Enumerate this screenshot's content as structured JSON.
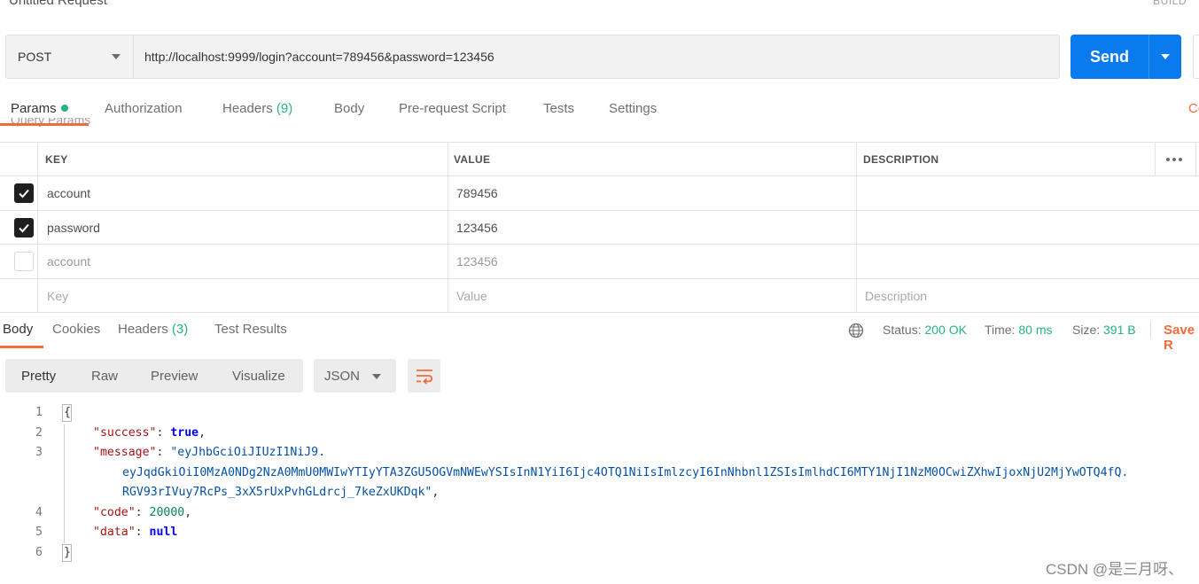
{
  "header": {
    "title": "Untitled Request",
    "build_label": "BUILD"
  },
  "request": {
    "method": "POST",
    "url": "http://localhost:9999/login?account=789456&password=123456",
    "send_label": "Send"
  },
  "request_tabs": {
    "params": "Params",
    "authorization": "Authorization",
    "headers": "Headers",
    "headers_count": "(9)",
    "body": "Body",
    "pre_request": "Pre-request Script",
    "tests": "Tests",
    "settings": "Settings",
    "cut_label": "Co"
  },
  "query_params": {
    "section_label": "Query Params",
    "columns": {
      "key": "KEY",
      "value": "VALUE",
      "description": "DESCRIPTION"
    },
    "rows": [
      {
        "key": "account",
        "value": "789456",
        "checked": true
      },
      {
        "key": "password",
        "value": "123456",
        "checked": true
      },
      {
        "key": "account",
        "value": "123456",
        "checked": false
      }
    ],
    "placeholders": {
      "key": "Key",
      "value": "Value",
      "description": "Description"
    }
  },
  "response_tabs": {
    "body": "Body",
    "cookies": "Cookies",
    "headers": "Headers",
    "headers_count": "(3)",
    "test_results": "Test Results"
  },
  "response_status": {
    "status_label": "Status:",
    "status_value": "200 OK",
    "time_label": "Time:",
    "time_value": "80 ms",
    "size_label": "Size:",
    "size_value": "391 B",
    "save_label": "Save R"
  },
  "format_bar": {
    "pretty": "Pretty",
    "raw": "Raw",
    "preview": "Preview",
    "visualize": "Visualize",
    "language": "JSON"
  },
  "response_body": {
    "line_numbers": [
      "1",
      "2",
      "3",
      "4",
      "5",
      "6"
    ],
    "open_brace": "{",
    "close_brace": "}",
    "success_key": "\"success\"",
    "success_value": "true",
    "message_key": "\"message\"",
    "message_line1": "\"eyJhbGciOiJIUzI1NiJ9.",
    "message_line2": "eyJqdGkiOiI0MzA0NDg2NzA0MmU0MWIwYTIyYTA3ZGU5OGVmNWEwYSIsInN1YiI6Ijc4OTQ1NiIsImlzcyI6InNhbnl1ZSIsImlhdCI6MTY1NjI1NzM0OCwiZXhwIjoxNjU2MjYwOTQ4fQ.",
    "message_line3": "RGV93rIVuy7RcPs_3xX5rUxPvhGLdrcj_7keZxUKDqk\"",
    "code_key": "\"code\"",
    "code_value": "20000",
    "data_key": "\"data\"",
    "data_value": "null"
  },
  "watermark": "CSDN @是三月呀、",
  "colors": {
    "accent": "#f26b3a",
    "send": "#097bed",
    "success": "#26b47f"
  }
}
